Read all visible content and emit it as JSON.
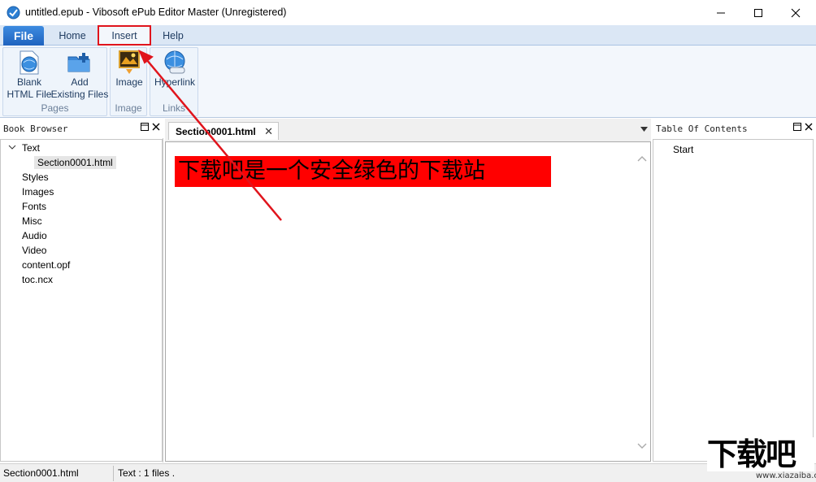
{
  "window": {
    "title": "untitled.epub - Vibosoft ePub Editor Master (Unregistered)",
    "minimize_glyph": "—",
    "maximize_glyph": "☐",
    "close_glyph": "✕"
  },
  "ribbon_tabs": {
    "file": "File",
    "home": "Home",
    "insert": "Insert",
    "help": "Help",
    "active": "Insert"
  },
  "ribbon": {
    "groups": {
      "pages": "Pages",
      "image": "Image",
      "links": "Links"
    },
    "buttons": {
      "blank_html_line1": "Blank",
      "blank_html_line2": "HTML File",
      "add_existing_line1": "Add",
      "add_existing_line2": "Existing Files",
      "image": "Image",
      "hyperlink": "Hyperlink"
    }
  },
  "book_browser": {
    "title": "Book Browser",
    "tree": {
      "text_folder": "Text",
      "text_children": [
        "Section0001.html"
      ],
      "folders": [
        "Styles",
        "Images",
        "Fonts",
        "Misc",
        "Audio",
        "Video",
        "content.opf",
        "toc.ncx"
      ]
    }
  },
  "editor": {
    "active_tab": "Section0001.html",
    "content_headline": "下载吧是一个安全绿色的下载站",
    "highlight_color": "#ff0000"
  },
  "toc": {
    "title": "Table Of Contents",
    "items": [
      "Start"
    ]
  },
  "statusbar": {
    "file": "Section0001.html",
    "info": "Text : 1 files ."
  },
  "watermark": {
    "brand": "下载吧",
    "url": "www.xiazaiba.com"
  },
  "colors": {
    "annotation_red": "#e0141c",
    "file_tab_blue": "#1f63bf",
    "ribbon_bg": "#f3f7fc"
  }
}
